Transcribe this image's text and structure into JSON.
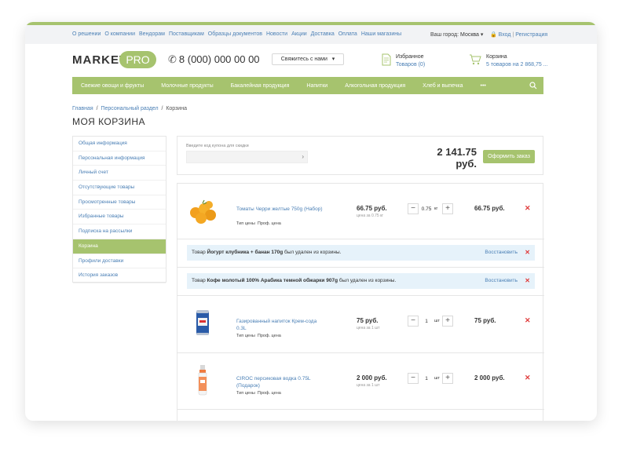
{
  "topbar": {
    "nav": [
      "О решении",
      "О компании",
      "Вендорам",
      "Поставщикам",
      "Образцы документов",
      "Новости",
      "Акции",
      "Доставка",
      "Оплата",
      "Наши магазины"
    ],
    "city_label": "Ваш город:",
    "city_value": "Москва",
    "login": "Вход",
    "separator": "|",
    "register": "Регистрация"
  },
  "header": {
    "logo_left": "MARKET",
    "logo_right": "PRO",
    "phone": "8 (000) 000 00 00",
    "callback": "Свяжитесь с нами",
    "favorites_title": "Избранное",
    "favorites_sub": "Товаров (0)",
    "cart_title": "Корзина",
    "cart_sub": "5 товаров на 2 868,75 ..."
  },
  "menu": [
    "Свежие овощи и фрукты",
    "Молочные продукты",
    "Бакалейная продукция",
    "Напитки",
    "Алкогольная продукция",
    "Хлеб и выпечка",
    "•••"
  ],
  "breadcrumb": {
    "home": "Главная",
    "sep": "/",
    "section": "Персональный раздел",
    "current": "Корзина"
  },
  "page_title": "МОЯ КОРЗИНА",
  "sidebar": [
    "Общая информация",
    "Персональная информация",
    "Личный счет",
    "Отсутствующие товары",
    "Просмотренные товары",
    "Избранные товары",
    "Подписка на рассылки",
    "Корзина",
    "Профили доставки",
    "История заказов"
  ],
  "coupon": {
    "label": "Введите код купона для скидки",
    "arrow": "›"
  },
  "total": "2 141.75 руб.",
  "order_button": "Оформить заказ",
  "items": [
    {
      "name": "Томаты Черри желтые 750g (Набор)",
      "price_type_label": "Тип цены",
      "price_type": "Проф. цена",
      "price": "66.75 руб.",
      "unit_price": "цена за 0.75 кг",
      "qty": "0.75",
      "unit": "кг",
      "sum": "66.75 руб."
    },
    {
      "name": "Газированный напиток Крем-сода 0.3L",
      "price_type_label": "Тип цены",
      "price_type": "Проф. цена",
      "price": "75 руб.",
      "unit_price": "цена за 1 шт",
      "qty": "1",
      "unit": "шт",
      "sum": "75 руб."
    },
    {
      "name": "CIROC персиковая водка 0.75L (Подарок)",
      "price_type_label": "Тип цены",
      "price_type": "Проф. цена",
      "price": "2 000 руб.",
      "unit_price": "цена за 1 шт",
      "qty": "1",
      "unit": "шт",
      "sum": "2 000 руб."
    }
  ],
  "removed": [
    {
      "prefix": "Товар",
      "product": "Йогурт клубника + банан 170g",
      "suffix": "был удален из корзины.",
      "restore": "Восстановить"
    },
    {
      "prefix": "Товар",
      "product": "Кофе молотый 100% Арабика темной обжарки 907g",
      "suffix": "был удален из корзины.",
      "restore": "Восстановить"
    }
  ],
  "controls": {
    "minus": "−",
    "plus": "+",
    "delete": "✕"
  },
  "colors": {
    "accent": "#a6c36e",
    "link": "#4a7fb5",
    "delete": "#e03b3b",
    "notice_bg": "#e6f2fa"
  }
}
